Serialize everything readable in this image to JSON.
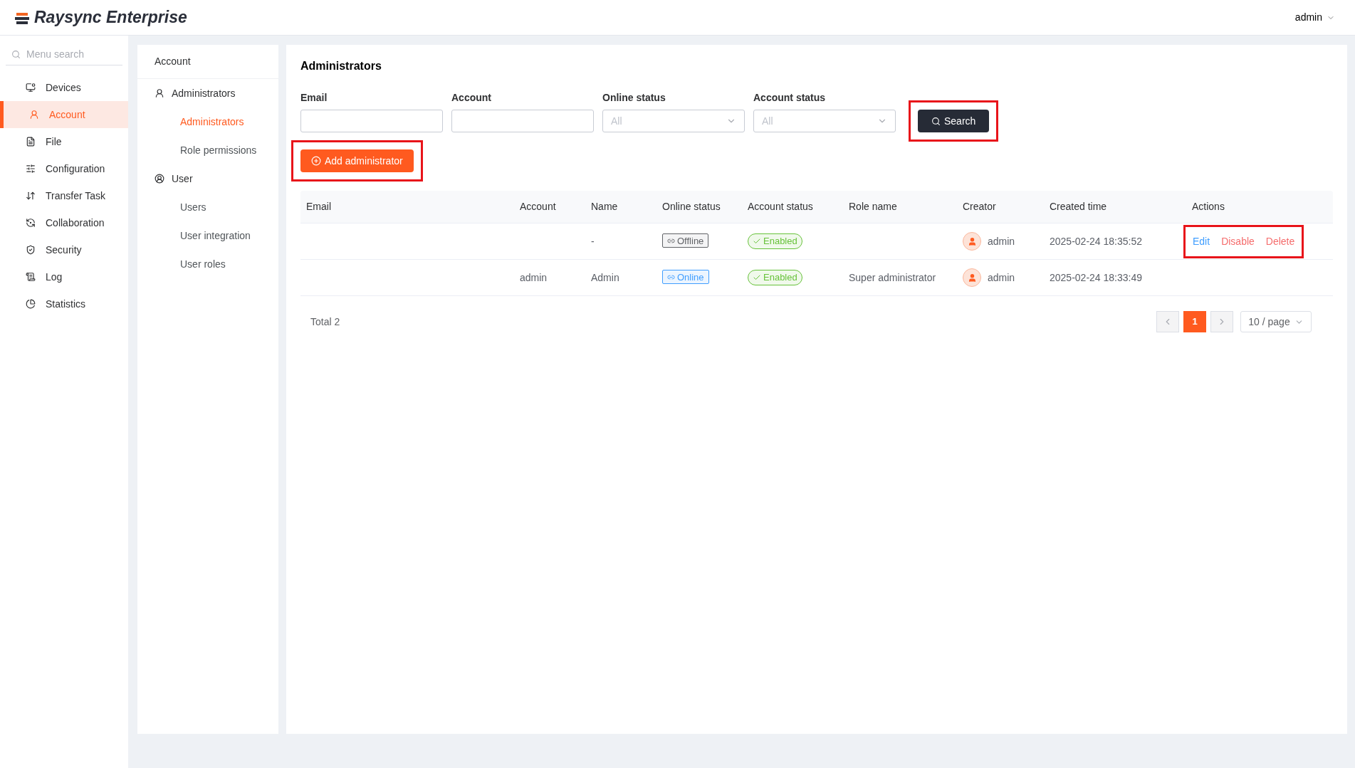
{
  "header": {
    "brand": "Raysync Enterprise",
    "user": "admin"
  },
  "sidebar": {
    "search_placeholder": "Menu search",
    "items": [
      {
        "label": "Devices",
        "selected": false
      },
      {
        "label": "Account",
        "selected": true
      },
      {
        "label": "File",
        "selected": false
      },
      {
        "label": "Configuration",
        "selected": false
      },
      {
        "label": "Transfer Task",
        "selected": false
      },
      {
        "label": "Collaboration",
        "selected": false
      },
      {
        "label": "Security",
        "selected": false
      },
      {
        "label": "Log",
        "selected": false
      },
      {
        "label": "Statistics",
        "selected": false
      }
    ]
  },
  "submenu": {
    "title": "Account",
    "groups": [
      {
        "label": "Administrators",
        "children": [
          {
            "label": "Administrators",
            "selected": true
          },
          {
            "label": "Role permissions",
            "selected": false
          }
        ]
      },
      {
        "label": "User",
        "children": [
          {
            "label": "Users",
            "selected": false
          },
          {
            "label": "User integration",
            "selected": false
          },
          {
            "label": "User roles",
            "selected": false
          }
        ]
      }
    ]
  },
  "main": {
    "title": "Administrators",
    "filters": [
      {
        "label": "Email",
        "kind": "input"
      },
      {
        "label": "Account",
        "kind": "input"
      },
      {
        "label": "Online status",
        "kind": "select",
        "placeholder": "All"
      },
      {
        "label": "Account status",
        "kind": "select",
        "placeholder": "All"
      }
    ],
    "search_button": {
      "label": "Search",
      "highlighted": true
    },
    "add_button": {
      "label": "Add administrator",
      "highlighted": true
    },
    "table": {
      "columns": [
        "Email",
        "Account",
        "Name",
        "Online status",
        "Account status",
        "Role name",
        "Creator",
        "Created time",
        "Actions"
      ],
      "rows": [
        {
          "name": "-",
          "online": {
            "label": "Offline",
            "kind": "offline"
          },
          "account_status": "Enabled",
          "creator": "admin",
          "created": "2025-02-24 18:35:52",
          "actions": [
            {
              "label": "Edit",
              "kind": "edit"
            },
            {
              "label": "Disable",
              "kind": "danger"
            },
            {
              "label": "Delete",
              "kind": "danger"
            }
          ],
          "actions_highlighted": true
        },
        {
          "account": "admin",
          "name": "Admin",
          "online": {
            "label": "Online",
            "kind": "online"
          },
          "account_status": "Enabled",
          "role": "Super administrator",
          "creator": "admin",
          "created": "2025-02-24 18:33:49",
          "actions": []
        }
      ]
    },
    "pagination": {
      "total": "Total 2",
      "pages": [
        {
          "label": "1",
          "selected": true
        }
      ],
      "page_size": "10 / page"
    }
  }
}
